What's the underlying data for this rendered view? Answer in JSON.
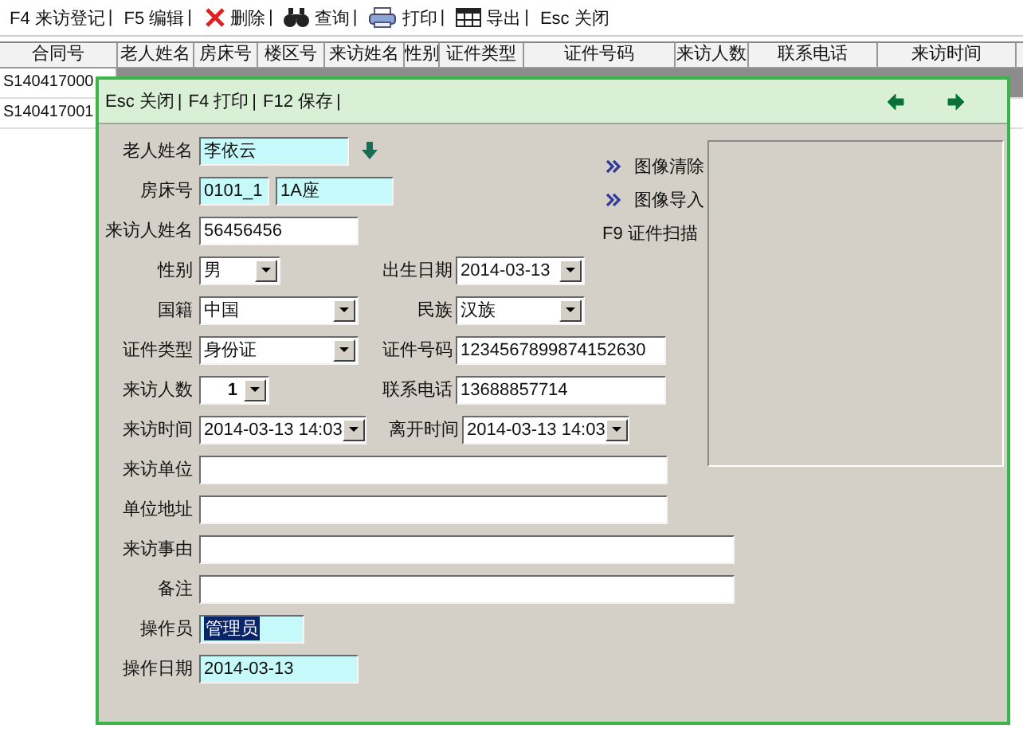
{
  "toolbar": [
    {
      "label": "F4 来访登记",
      "separator": "|"
    },
    {
      "label": "F5 编辑",
      "separator": "|"
    },
    {
      "label": "删除",
      "separator": "|"
    },
    {
      "label": "查询",
      "separator": "|"
    },
    {
      "label": "打印",
      "separator": "|"
    },
    {
      "label": "导出",
      "separator": "|"
    },
    {
      "label": "Esc 关闭"
    }
  ],
  "table": {
    "columns": [
      "合同号",
      "老人姓名",
      "房床号",
      "楼区号",
      "来访姓名",
      "性别",
      "证件类型",
      "证件号码",
      "来访人数",
      "联系电话",
      "来访时间"
    ],
    "rows": [
      {
        "column_1": "S140417000",
        "selected": true
      },
      {
        "column_1": "S140417001",
        "selected": false
      }
    ]
  },
  "dialog": {
    "toolbar": [
      {
        "label": "Esc 关闭",
        "separator": "|"
      },
      {
        "label": "F4 打印",
        "separator": "|"
      },
      {
        "label": "F12 保存",
        "separator": "|"
      }
    ],
    "rows": [
      [
        {
          "label": "老人姓名",
          "kind": "text",
          "value": "李依云",
          "readonly": true
        }
      ],
      [
        {
          "label": "房床号",
          "kind": "text",
          "value": "0101_1",
          "readonly": true
        },
        {
          "kind": "text",
          "value": "1A座",
          "readonly": true
        }
      ],
      [
        {
          "label": "来访人姓名",
          "kind": "text",
          "value": "56456456",
          "readonly": false
        }
      ],
      [
        {
          "label": "性别",
          "kind": "combo",
          "value": "男"
        },
        {
          "label": "出生日期",
          "kind": "combo",
          "value": "2014-03-13"
        }
      ],
      [
        {
          "label": "国籍",
          "kind": "combo",
          "value": "中国"
        },
        {
          "label": "民族",
          "kind": "combo",
          "value": "汉族"
        }
      ],
      [
        {
          "label": "证件类型",
          "kind": "combo",
          "value": "身份证"
        },
        {
          "label": "证件号码",
          "kind": "text",
          "value": "1234567899874152630",
          "readonly": false
        }
      ],
      [
        {
          "label": "来访人数",
          "kind": "number",
          "value": "1"
        },
        {
          "label": "联系电话",
          "kind": "text",
          "value": "13688857714",
          "readonly": false
        }
      ],
      [
        {
          "label": "来访时间",
          "kind": "combo",
          "value": "2014-03-13 14:03"
        },
        {
          "label": "离开时间",
          "kind": "combo",
          "value": "2014-03-13 14:03"
        }
      ],
      [
        {
          "label": "来访单位",
          "kind": "text",
          "readonly": false
        }
      ],
      [
        {
          "label": "单位地址",
          "kind": "text",
          "readonly": false
        }
      ],
      [
        {
          "label": "来访事由",
          "kind": "text",
          "readonly": false
        }
      ],
      [
        {
          "label": "备注",
          "kind": "text",
          "readonly": false
        }
      ],
      [
        {
          "label": "操作员",
          "kind": "text",
          "value": "管理员",
          "readonly": true,
          "text_selected": true
        }
      ],
      [
        {
          "label": "操作日期",
          "kind": "text",
          "value": "2014-03-13",
          "readonly": true
        }
      ]
    ],
    "links": [
      {
        "label": "图像清除",
        "kind": "link"
      },
      {
        "label": "图像导入",
        "kind": "link"
      },
      {
        "label": "F9 证件扫描",
        "kind": "key"
      }
    ]
  }
}
